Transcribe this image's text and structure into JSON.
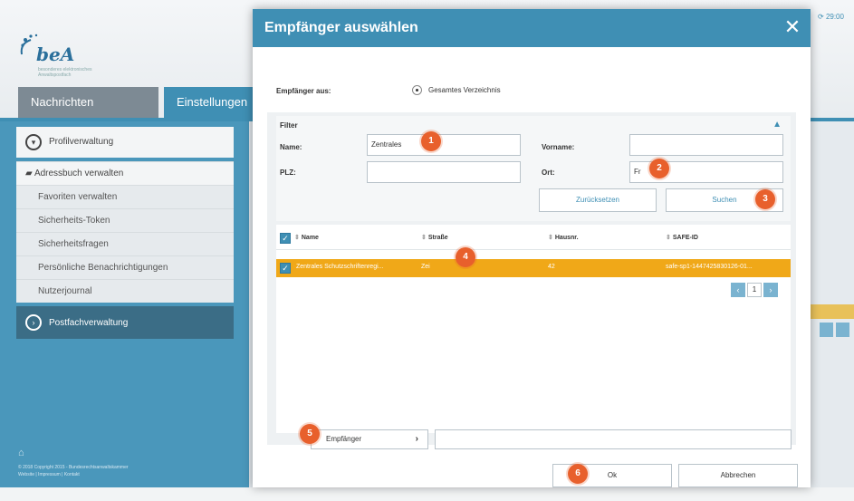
{
  "app": {
    "logo_text": "beA",
    "logo_subtext": "besonderes elektronisches Anwaltspostfach",
    "tabs": [
      "Nachrichten",
      "Einstellungen"
    ],
    "sync_label": "29:00"
  },
  "sidebar": {
    "profile_label": "Profilverwaltung",
    "addressbook_label": "Adressbuch verwalten",
    "items": [
      "Favoriten verwalten",
      "Sicherheits-Token",
      "Sicherheitsfragen",
      "Persönliche Benachrichtigungen",
      "Nutzerjournal"
    ],
    "postbox_label": "Postfachverwaltung",
    "footer_line1": "© 2018 Copyright 2015 - Bundesrechtsanwaltskammer",
    "footer_line2": "Website | Impressum | Kontakt"
  },
  "dialog": {
    "title": "Empfänger auswählen",
    "recipients_from_label": "Empfänger aus:",
    "radio_label": "Gesamtes Verzeichnis",
    "filter_label": "Filter",
    "fields": {
      "name_label": "Name:",
      "name_value": "Zentrales",
      "firstname_label": "Vorname:",
      "firstname_value": "",
      "zip_label": "PLZ:",
      "zip_value": "",
      "city_label": "Ort:",
      "city_value": "Fr"
    },
    "reset_label": "Zurücksetzen",
    "search_label": "Suchen",
    "table": {
      "headers": [
        "Name",
        "Straße",
        "Hausnr.",
        "SAFE-ID"
      ],
      "rows": [
        [
          "Zentrales Schutzschriftenregi...",
          "Zei",
          "42",
          "safe-sp1-1447425830126-01..."
        ]
      ]
    },
    "page_number": "1",
    "recipient_button_label": "Empfänger",
    "ok_label": "Ok",
    "cancel_label": "Abbrechen"
  },
  "callouts": [
    "1",
    "2",
    "3",
    "4",
    "5",
    "6"
  ],
  "colors": {
    "primary_blue": "#3f8fb4",
    "selected_row": "#f0a818",
    "callout": "#e8602c"
  }
}
